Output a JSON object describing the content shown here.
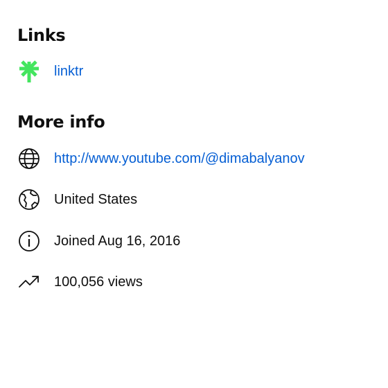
{
  "links": {
    "title": "Links",
    "items": [
      {
        "icon": "linktree-asterisk-icon",
        "label": "linktr",
        "accent": "#43e55e"
      }
    ]
  },
  "more_info": {
    "title": "More info",
    "url": "http://www.youtube.com/@dimabalyanov",
    "country": "United States",
    "joined": "Joined Aug 16, 2016",
    "views": "100,056 views"
  },
  "colors": {
    "link": "#065fd4",
    "text": "#0f0f0f",
    "icon_stroke": "#0f0f0f"
  },
  "icons": [
    "linktree-asterisk-icon",
    "globe-icon",
    "earth-icon",
    "info-icon",
    "trending-icon"
  ]
}
